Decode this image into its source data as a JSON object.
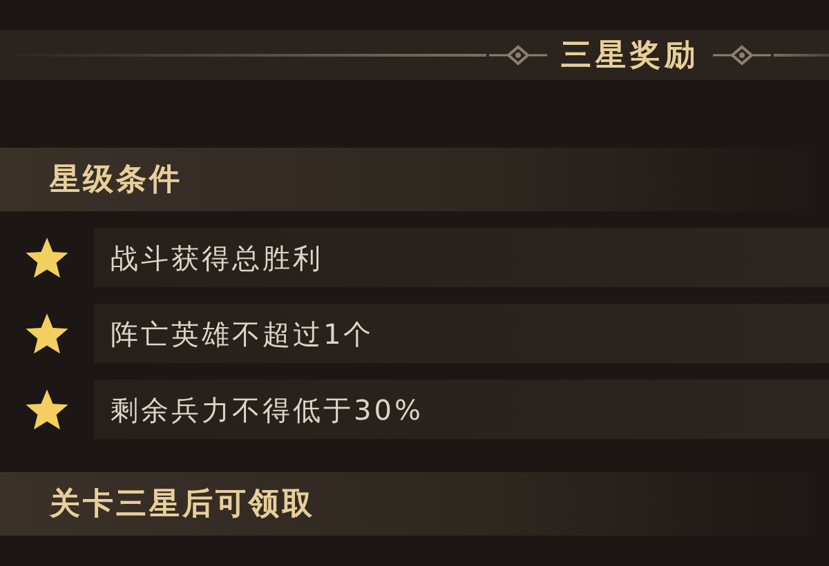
{
  "header": {
    "title": "三星奖励"
  },
  "conditions": {
    "title": "星级条件",
    "items": [
      {
        "text": "战斗获得总胜利",
        "achieved": true
      },
      {
        "text": "阵亡英雄不超过1个",
        "achieved": true
      },
      {
        "text": "剩余兵力不得低于30%",
        "achieved": true
      }
    ]
  },
  "footer": {
    "text": "关卡三星后可领取"
  }
}
